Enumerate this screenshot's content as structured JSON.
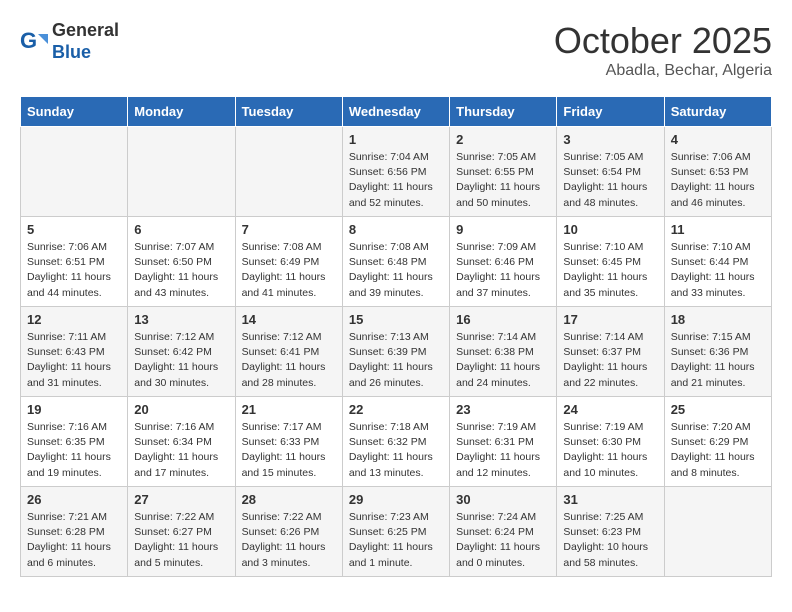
{
  "header": {
    "logo_line1": "General",
    "logo_line2": "Blue",
    "month": "October 2025",
    "location": "Abadla, Bechar, Algeria"
  },
  "days_of_week": [
    "Sunday",
    "Monday",
    "Tuesday",
    "Wednesday",
    "Thursday",
    "Friday",
    "Saturday"
  ],
  "weeks": [
    [
      {
        "num": "",
        "info": ""
      },
      {
        "num": "",
        "info": ""
      },
      {
        "num": "",
        "info": ""
      },
      {
        "num": "1",
        "info": "Sunrise: 7:04 AM\nSunset: 6:56 PM\nDaylight: 11 hours\nand 52 minutes."
      },
      {
        "num": "2",
        "info": "Sunrise: 7:05 AM\nSunset: 6:55 PM\nDaylight: 11 hours\nand 50 minutes."
      },
      {
        "num": "3",
        "info": "Sunrise: 7:05 AM\nSunset: 6:54 PM\nDaylight: 11 hours\nand 48 minutes."
      },
      {
        "num": "4",
        "info": "Sunrise: 7:06 AM\nSunset: 6:53 PM\nDaylight: 11 hours\nand 46 minutes."
      }
    ],
    [
      {
        "num": "5",
        "info": "Sunrise: 7:06 AM\nSunset: 6:51 PM\nDaylight: 11 hours\nand 44 minutes."
      },
      {
        "num": "6",
        "info": "Sunrise: 7:07 AM\nSunset: 6:50 PM\nDaylight: 11 hours\nand 43 minutes."
      },
      {
        "num": "7",
        "info": "Sunrise: 7:08 AM\nSunset: 6:49 PM\nDaylight: 11 hours\nand 41 minutes."
      },
      {
        "num": "8",
        "info": "Sunrise: 7:08 AM\nSunset: 6:48 PM\nDaylight: 11 hours\nand 39 minutes."
      },
      {
        "num": "9",
        "info": "Sunrise: 7:09 AM\nSunset: 6:46 PM\nDaylight: 11 hours\nand 37 minutes."
      },
      {
        "num": "10",
        "info": "Sunrise: 7:10 AM\nSunset: 6:45 PM\nDaylight: 11 hours\nand 35 minutes."
      },
      {
        "num": "11",
        "info": "Sunrise: 7:10 AM\nSunset: 6:44 PM\nDaylight: 11 hours\nand 33 minutes."
      }
    ],
    [
      {
        "num": "12",
        "info": "Sunrise: 7:11 AM\nSunset: 6:43 PM\nDaylight: 11 hours\nand 31 minutes."
      },
      {
        "num": "13",
        "info": "Sunrise: 7:12 AM\nSunset: 6:42 PM\nDaylight: 11 hours\nand 30 minutes."
      },
      {
        "num": "14",
        "info": "Sunrise: 7:12 AM\nSunset: 6:41 PM\nDaylight: 11 hours\nand 28 minutes."
      },
      {
        "num": "15",
        "info": "Sunrise: 7:13 AM\nSunset: 6:39 PM\nDaylight: 11 hours\nand 26 minutes."
      },
      {
        "num": "16",
        "info": "Sunrise: 7:14 AM\nSunset: 6:38 PM\nDaylight: 11 hours\nand 24 minutes."
      },
      {
        "num": "17",
        "info": "Sunrise: 7:14 AM\nSunset: 6:37 PM\nDaylight: 11 hours\nand 22 minutes."
      },
      {
        "num": "18",
        "info": "Sunrise: 7:15 AM\nSunset: 6:36 PM\nDaylight: 11 hours\nand 21 minutes."
      }
    ],
    [
      {
        "num": "19",
        "info": "Sunrise: 7:16 AM\nSunset: 6:35 PM\nDaylight: 11 hours\nand 19 minutes."
      },
      {
        "num": "20",
        "info": "Sunrise: 7:16 AM\nSunset: 6:34 PM\nDaylight: 11 hours\nand 17 minutes."
      },
      {
        "num": "21",
        "info": "Sunrise: 7:17 AM\nSunset: 6:33 PM\nDaylight: 11 hours\nand 15 minutes."
      },
      {
        "num": "22",
        "info": "Sunrise: 7:18 AM\nSunset: 6:32 PM\nDaylight: 11 hours\nand 13 minutes."
      },
      {
        "num": "23",
        "info": "Sunrise: 7:19 AM\nSunset: 6:31 PM\nDaylight: 11 hours\nand 12 minutes."
      },
      {
        "num": "24",
        "info": "Sunrise: 7:19 AM\nSunset: 6:30 PM\nDaylight: 11 hours\nand 10 minutes."
      },
      {
        "num": "25",
        "info": "Sunrise: 7:20 AM\nSunset: 6:29 PM\nDaylight: 11 hours\nand 8 minutes."
      }
    ],
    [
      {
        "num": "26",
        "info": "Sunrise: 7:21 AM\nSunset: 6:28 PM\nDaylight: 11 hours\nand 6 minutes."
      },
      {
        "num": "27",
        "info": "Sunrise: 7:22 AM\nSunset: 6:27 PM\nDaylight: 11 hours\nand 5 minutes."
      },
      {
        "num": "28",
        "info": "Sunrise: 7:22 AM\nSunset: 6:26 PM\nDaylight: 11 hours\nand 3 minutes."
      },
      {
        "num": "29",
        "info": "Sunrise: 7:23 AM\nSunset: 6:25 PM\nDaylight: 11 hours\nand 1 minute."
      },
      {
        "num": "30",
        "info": "Sunrise: 7:24 AM\nSunset: 6:24 PM\nDaylight: 11 hours\nand 0 minutes."
      },
      {
        "num": "31",
        "info": "Sunrise: 7:25 AM\nSunset: 6:23 PM\nDaylight: 10 hours\nand 58 minutes."
      },
      {
        "num": "",
        "info": ""
      }
    ]
  ]
}
